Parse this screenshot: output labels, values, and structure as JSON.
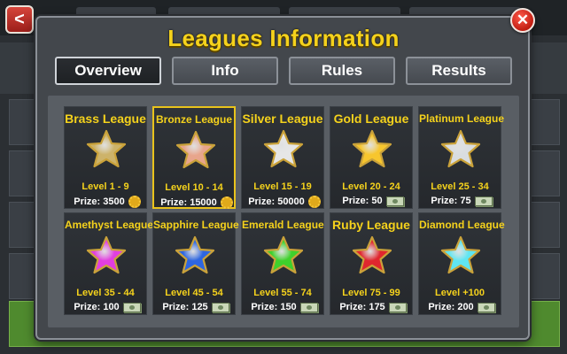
{
  "title": "Leagues Information",
  "close_label": "✕",
  "back_label": "<",
  "tabs": [
    {
      "label": "Overview",
      "active": true
    },
    {
      "label": "Info",
      "active": false
    },
    {
      "label": "Rules",
      "active": false
    },
    {
      "label": "Results",
      "active": false
    }
  ],
  "leagues": [
    {
      "name": "Brass League",
      "level": "Level 1 - 9",
      "prize": "Prize: 3500",
      "prize_icon": "coin-gear-icon",
      "color": "#cdb36a",
      "selected": false
    },
    {
      "name": "Bronze League",
      "level": "Level 10 - 14",
      "prize": "Prize: 15000",
      "prize_icon": "coin-gear-icon",
      "color": "#e8a58c",
      "selected": true
    },
    {
      "name": "Silver League",
      "level": "Level 15 - 19",
      "prize": "Prize: 50000",
      "prize_icon": "coin-gear-icon",
      "color": "#e6e6e6",
      "selected": false
    },
    {
      "name": "Gold League",
      "level": "Level 20 - 24",
      "prize": "Prize: 50",
      "prize_icon": "cash-icon",
      "color": "#f7c62e",
      "selected": false
    },
    {
      "name": "Platinum League",
      "level": "Level 25 - 34",
      "prize": "Prize: 75",
      "prize_icon": "cash-icon",
      "color": "#d9dde0",
      "selected": false
    },
    {
      "name": "Amethyst League",
      "level": "Level 35 - 44",
      "prize": "Prize: 100",
      "prize_icon": "cash-icon",
      "color": "#e23ee0",
      "selected": false
    },
    {
      "name": "Sapphire League",
      "level": "Level 45 - 54",
      "prize": "Prize: 125",
      "prize_icon": "cash-icon",
      "color": "#2e66e0",
      "selected": false
    },
    {
      "name": "Emerald League",
      "level": "Level 55 - 74",
      "prize": "Prize: 150",
      "prize_icon": "cash-icon",
      "color": "#3fd12c",
      "selected": false
    },
    {
      "name": "Ruby League",
      "level": "Level 75 - 99",
      "prize": "Prize: 175",
      "prize_icon": "cash-icon",
      "color": "#e0262e",
      "selected": false
    },
    {
      "name": "Diamond League",
      "level": "Level +100",
      "prize": "Prize: 200",
      "prize_icon": "cash-icon",
      "color": "#5fe6f2",
      "selected": false
    }
  ]
}
